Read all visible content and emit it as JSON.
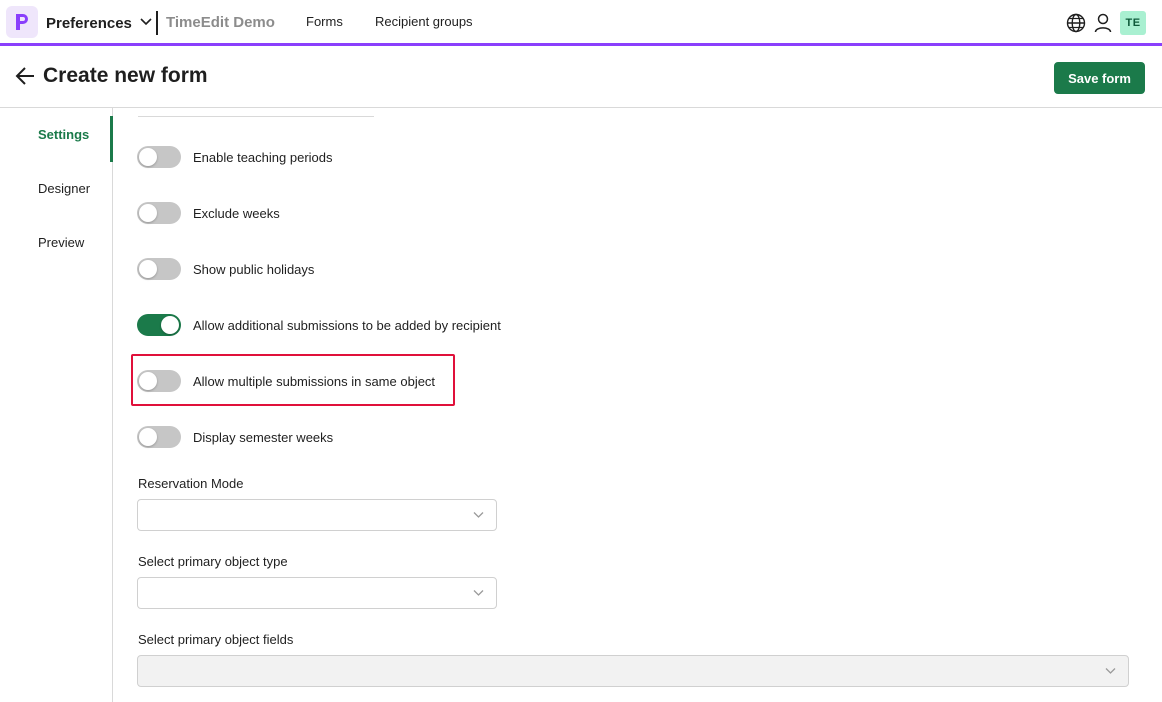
{
  "topbar": {
    "app_name": "Preferences",
    "org_name": "TimeEdit Demo",
    "nav": [
      "Forms",
      "Recipient groups"
    ],
    "user_badge": "TE",
    "icons": [
      "logo-icon",
      "chevron-down-icon",
      "globe-icon",
      "user-icon"
    ],
    "accent_color": "#8a3ffc"
  },
  "header": {
    "title": "Create new form",
    "save_label": "Save form",
    "primary_color": "#1b7a4a"
  },
  "sidebar": {
    "items": [
      {
        "label": "Settings",
        "active": true
      },
      {
        "label": "Designer",
        "active": false
      },
      {
        "label": "Preview",
        "active": false
      }
    ]
  },
  "settings": {
    "toggles": [
      {
        "label": "Enable teaching periods",
        "on": false
      },
      {
        "label": "Exclude weeks",
        "on": false
      },
      {
        "label": "Show public holidays",
        "on": false
      },
      {
        "label": "Allow additional submissions to be added by recipient",
        "on": true
      },
      {
        "label": "Allow multiple submissions in same object",
        "on": false,
        "highlighted": true
      },
      {
        "label": "Display semester weeks",
        "on": false
      }
    ],
    "fields": [
      {
        "label": "Reservation Mode",
        "value": ""
      },
      {
        "label": "Select primary object type",
        "value": ""
      },
      {
        "label": "Select primary object fields",
        "value": ""
      }
    ]
  }
}
